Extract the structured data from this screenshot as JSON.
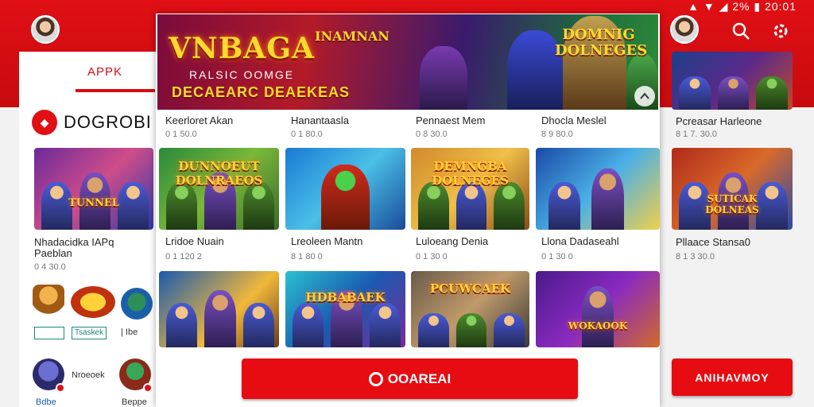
{
  "status": {
    "text": "▲ ▼ ◢ 2% ▮ 20:01"
  },
  "header": {
    "search_icon": "search-icon",
    "settings_icon": "gear-icon"
  },
  "left": {
    "tab_label": "APPK",
    "brand": {
      "logo_text": "◆",
      "name": "DOGROBI"
    },
    "featured": {
      "title": "Nhadacidka IAPq",
      "subtitle": "Paeblan",
      "meta": "0 4 30.0"
    },
    "badges": [
      "",
      "Tsaskek",
      "| Ibe"
    ],
    "bottom_text": "Nroeoek",
    "bottom_labels": [
      "Bdbe",
      "Beppe"
    ]
  },
  "banner": {
    "logo": "VNBAGA",
    "logo2": "INAMNAN",
    "sub1": "RALSIC OOMGE",
    "sub2": "DECAEARC DEAEKEAS",
    "right_logo": "DOMNIG DOLNEGES"
  },
  "dialog": {
    "cards_row0": [
      {
        "title": "Keerloret Akan",
        "meta": "0 1 50.0"
      },
      {
        "title": "Hanantaasla",
        "meta": "0 1 80.0"
      },
      {
        "title": "Pennaest Mem",
        "meta": "0 8 30.0"
      },
      {
        "title": "Dhocla Meslel",
        "meta": "8 9 80.0"
      }
    ],
    "cards_row1": [
      {
        "logo": "DUNNOEUT DOLNRAEOS",
        "title": "Lridoe Nuain",
        "meta": "0 1 120 2"
      },
      {
        "logo": "",
        "title": "Lreoleen Mantn",
        "meta": "8 1 80 0"
      },
      {
        "logo": "DEMNGBA DOLNEGES",
        "title": "Luloeang Denia",
        "meta": "0 1 30 0"
      },
      {
        "logo": "",
        "title": "Llona Dadaseahl",
        "meta": "0 1 30 0"
      }
    ],
    "cards_row2": [
      {
        "logo": ""
      },
      {
        "logo": "HDBABAEK"
      },
      {
        "logo": "PCUWCAEK"
      },
      {
        "logo": "WOKAOOK"
      }
    ],
    "download_label": "OOAREAI"
  },
  "right": {
    "card0": {
      "title": "Pcreasar Harleone",
      "meta": "8 1 7. 30.0"
    },
    "card1": {
      "logo": "SUTICAK DOLNEAS",
      "title": "Pllaace Stansa0",
      "meta": "8 1 3 30.0"
    },
    "button_label": "ANIHAVMOY"
  }
}
